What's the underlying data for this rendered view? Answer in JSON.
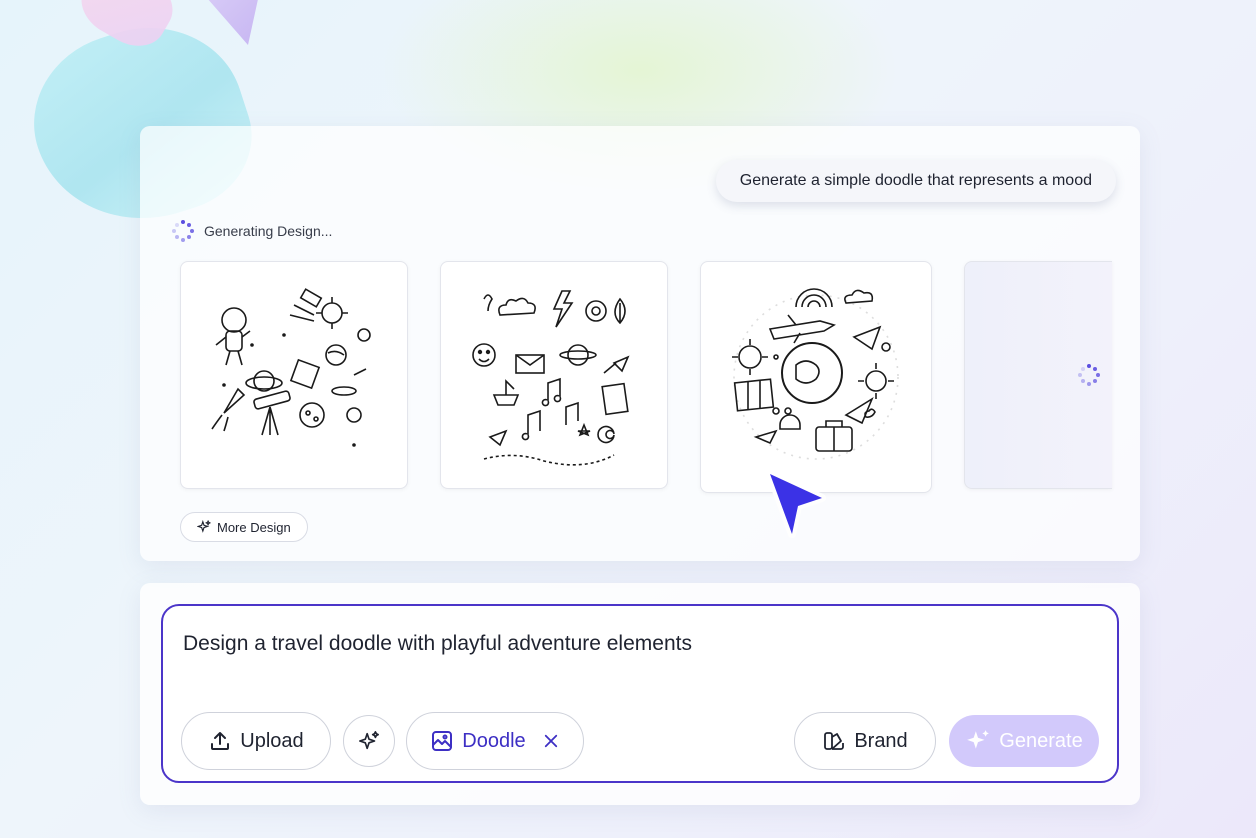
{
  "chat": {
    "prompt": "Generate a simple doodle that represents a mood",
    "status": "Generating Design..."
  },
  "gallery": {
    "cards": [
      {
        "subject": "space doodle"
      },
      {
        "subject": "mood doodle"
      },
      {
        "subject": "travel doodle"
      },
      {
        "subject": "loading"
      }
    ],
    "more_label": "More Design"
  },
  "composer": {
    "text": "Design a travel doodle with playful adventure elements",
    "upload_label": "Upload",
    "style_chip_label": "Doodle",
    "brand_label": "Brand",
    "generate_label": "Generate"
  },
  "colors": {
    "accent": "#4b35c9",
    "generate_bg": "#d2c9fb",
    "cursor": "#3b32e6"
  },
  "icons": [
    "spinner-icon",
    "sparkle-icon",
    "upload-icon",
    "magic-icon",
    "image-style-icon",
    "close-icon",
    "brand-icon",
    "cursor-icon"
  ]
}
